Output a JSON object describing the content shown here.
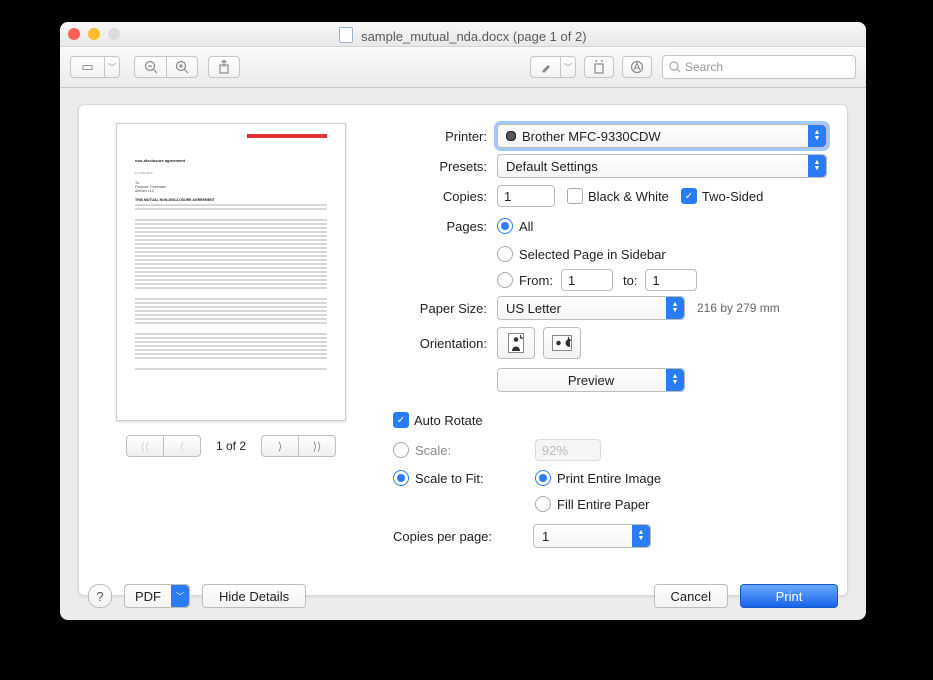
{
  "title": "sample_mutual_nda.docx (page 1 of 2)",
  "toolbar": {
    "search_placeholder": "Search"
  },
  "preview": {
    "page_indicator": "1 of 2"
  },
  "labels": {
    "printer": "Printer:",
    "presets": "Presets:",
    "copies": "Copies:",
    "pages": "Pages:",
    "paper_size": "Paper Size:",
    "orientation": "Orientation:",
    "copies_per_page": "Copies per page:"
  },
  "printer": {
    "name": "Brother MFC-9330CDW"
  },
  "presets": {
    "value": "Default Settings"
  },
  "copies": {
    "value": "1",
    "bw_label": "Black & White",
    "twosided_label": "Two-Sided"
  },
  "pages": {
    "all_label": "All",
    "selected_label": "Selected Page in Sidebar",
    "from_label": "From:",
    "to_label": "to:",
    "from_value": "1",
    "to_value": "1"
  },
  "paper": {
    "size": "US Letter",
    "dims": "216 by 279 mm"
  },
  "section_popup": "Preview",
  "auto_rotate_label": "Auto Rotate",
  "scale": {
    "scale_label": "Scale:",
    "scale_to_fit_label": "Scale to Fit:",
    "scale_value": "92%",
    "print_entire_label": "Print Entire Image",
    "fill_paper_label": "Fill Entire Paper"
  },
  "copies_per_page_value": "1",
  "footer": {
    "pdf": "PDF",
    "hide_details": "Hide Details",
    "cancel": "Cancel",
    "print": "Print"
  }
}
